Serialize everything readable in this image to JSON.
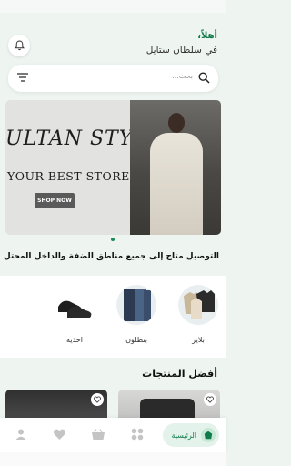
{
  "header": {
    "greeting": "أهلاً،",
    "subtitle": "في سلطان ستايل"
  },
  "search": {
    "placeholder": "بحث..."
  },
  "banner": {
    "script_text": "ULTAN STYLE",
    "headline": "YOUR BEST STORE",
    "cta_label": "SHOP NOW"
  },
  "delivery_notice": "التوصيل متاح إلى جميع مناطق الضفة والداخل المحتل",
  "categories": [
    {
      "label": "بلايز"
    },
    {
      "label": "بنطلون"
    },
    {
      "label": "احذيه"
    }
  ],
  "products_section": {
    "title": "أفضل المنتجات"
  },
  "bottom_nav": {
    "home_label": "الرئيسية"
  },
  "colors": {
    "accent": "#0f7a4a",
    "background": "#eef5f1"
  }
}
